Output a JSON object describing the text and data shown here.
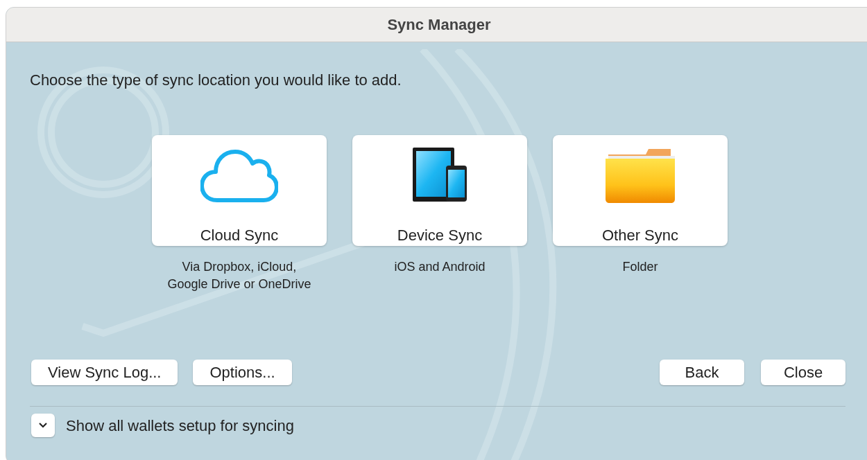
{
  "window": {
    "title": "Sync Manager"
  },
  "prompt": "Choose the type of sync location you would like to add.",
  "options": [
    {
      "kind": "cloud",
      "label": "Cloud Sync",
      "description": "Via Dropbox, iCloud,\nGoogle Drive or OneDrive"
    },
    {
      "kind": "device",
      "label": "Device Sync",
      "description": "iOS and Android"
    },
    {
      "kind": "folder",
      "label": "Other Sync",
      "description": "Folder"
    }
  ],
  "left_buttons": [
    "View Sync Log...",
    "Options..."
  ],
  "right_buttons": [
    "Back",
    "Close"
  ],
  "disclosure": {
    "label": "Show all wallets setup for syncing",
    "expanded": false
  }
}
